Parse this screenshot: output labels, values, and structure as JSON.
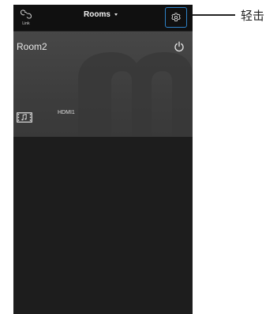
{
  "header": {
    "link_label": "Link",
    "rooms_dropdown_label": "Rooms",
    "link_icon": "link-icon",
    "settings_icon": "gear-icon",
    "caret_icon": "chevron-down-icon"
  },
  "room": {
    "name": "Room2",
    "power_icon": "power-icon",
    "source_icon": "film-music-icon",
    "source_label": "HDMI1"
  },
  "callout": {
    "text": "轻击"
  },
  "colors": {
    "highlight_border": "#2e82c8",
    "topbar": "#101010",
    "card": "#424242",
    "background": "#1d1d1d"
  }
}
